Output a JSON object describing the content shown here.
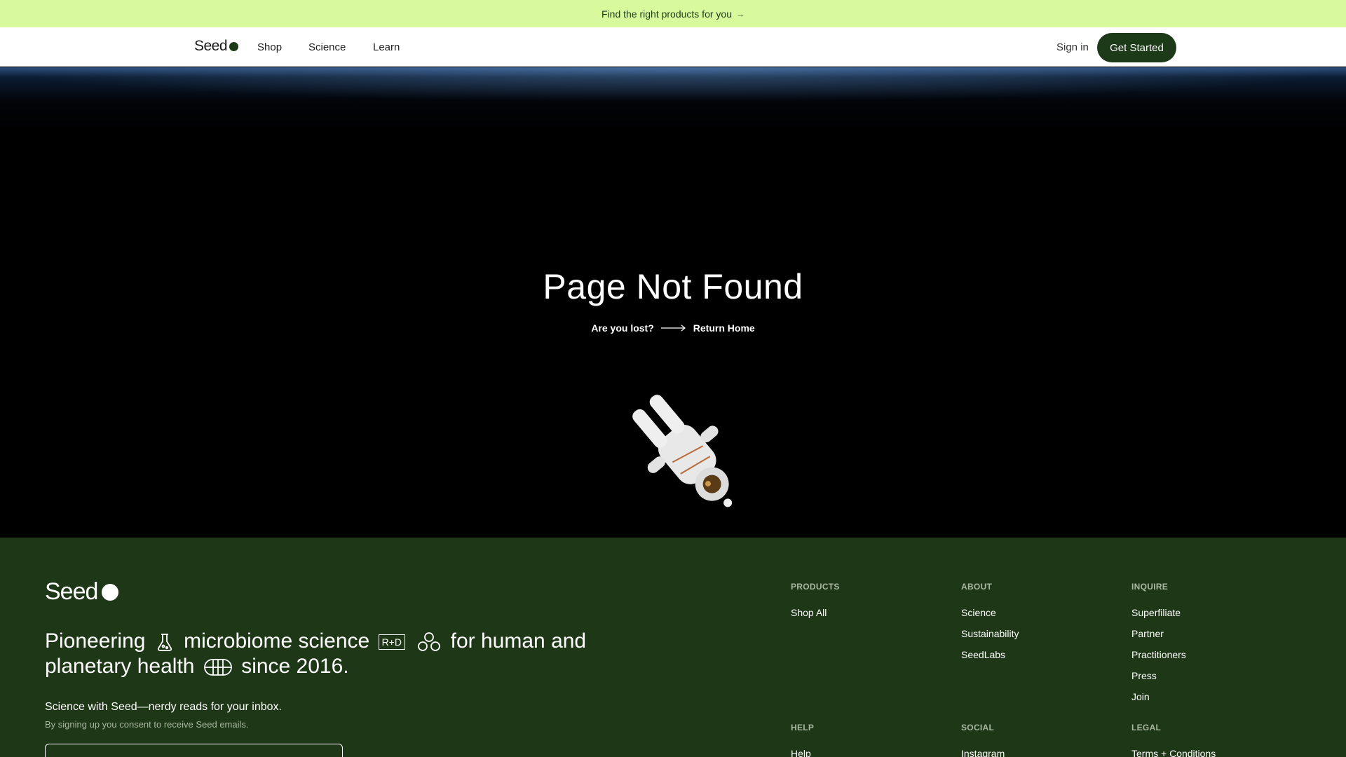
{
  "promo": {
    "text": "Find the right products for you",
    "arrow": "→"
  },
  "nav": {
    "logo": "Seed",
    "links": [
      "Shop",
      "Science",
      "Learn"
    ],
    "signin": "Sign in",
    "cta": "Get Started"
  },
  "hero": {
    "title": "Page Not Found",
    "lost": "Are you lost?",
    "return": "Return Home"
  },
  "footer": {
    "logo": "Seed",
    "mission": {
      "part1": "Pioneering",
      "part2": "microbiome science",
      "rd": "R+D",
      "part3": "for human and",
      "part4": "planetary health",
      "part5": "since 2016."
    },
    "newsletter": {
      "title": "Science with Seed—nerdy reads for your inbox.",
      "note": "By signing up you consent to receive Seed emails."
    },
    "columns": [
      {
        "head": "PRODUCTS",
        "items": [
          "Shop All"
        ]
      },
      {
        "head": "ABOUT",
        "items": [
          "Science",
          "Sustainability",
          "SeedLabs"
        ]
      },
      {
        "head": "INQUIRE",
        "items": [
          "Superfiliate",
          "Partner",
          "Practitioners",
          "Press",
          "Join"
        ]
      },
      {
        "head": "HELP",
        "items": [
          "Help"
        ]
      },
      {
        "head": "SOCIAL",
        "items": [
          "Instagram"
        ]
      },
      {
        "head": "LEGAL",
        "items": [
          "Terms + Conditions"
        ]
      }
    ]
  },
  "colors": {
    "promo_bg": "#d9f99d",
    "brand_green": "#1c3a17",
    "footer_bg": "#1e3717"
  },
  "icons": [
    "arrow-right-icon",
    "long-arrow-icon",
    "astronaut-illustration",
    "petri-dish-icon",
    "microbe-icon",
    "globe-icon"
  ]
}
